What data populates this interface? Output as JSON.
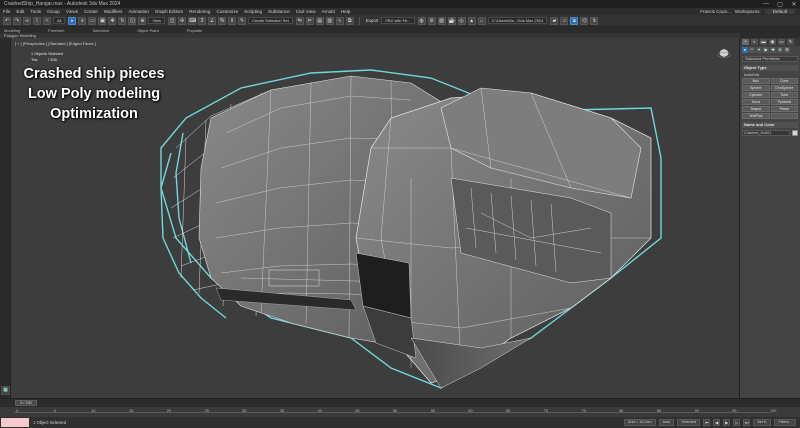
{
  "window": {
    "title": "CrashedShip_Hangar.max - Autodesk 3ds Max 2024",
    "min_label": "—",
    "max_label": "▢",
    "close_label": "✕"
  },
  "menu": {
    "items": [
      "File",
      "Edit",
      "Tools",
      "Group",
      "Views",
      "Create",
      "Modifiers",
      "Animation",
      "Graph Editors",
      "Rendering",
      "Customize",
      "Scripting",
      "Substance",
      "Civil View",
      "Arnold",
      "Help"
    ],
    "user": "Francis Coun...",
    "workspaces_label": "Workspaces:",
    "workspace_value": "Default"
  },
  "toolbar": {
    "undo_label": "↶",
    "redo_label": "↷",
    "filter_value": "All",
    "view_value": "View",
    "selection_set_value": "Create Selection Set",
    "export_label": "Export",
    "fbx_value": "FBX with Fb...",
    "project_value": "C:\\Users\\Ma...\\3ds Max 2024"
  },
  "ribbon": {
    "tabs": [
      "Modeling",
      "Freeform",
      "Selection",
      "Object Paint",
      "Populate"
    ],
    "sub_label": "Polygon Modeling"
  },
  "viewport": {
    "label": "[ + ] [Perspective ] [Standard ] [Edged Faces ]",
    "stats_selected": "1 Objects Selected",
    "stats_tris_label": "Tris:",
    "stats_tris_value": "7 836",
    "caption_line1": "Crashed ship pieces",
    "caption_line2": "Low Poly modeling",
    "caption_line3": "Optimization"
  },
  "command_panel": {
    "tabs": [
      "+",
      "◐",
      "▬",
      "◉",
      "▭",
      "✎"
    ],
    "dropdown_value": "Standard Primitives",
    "object_type_title": "Object Type",
    "autogrid_label": "AutoGrid",
    "buttons": [
      "Box",
      "Cone",
      "Sphere",
      "GeoSphere",
      "Cylinder",
      "Tube",
      "Torus",
      "Pyramid",
      "Teapot",
      "Plane",
      "TextPlus",
      ""
    ],
    "name_color_title": "Name and Color",
    "name_value": "Crashed_Hull01",
    "swatch_color": "#d8d8d8"
  },
  "timeline": {
    "slider_label": "0 / 100",
    "ticks": [
      "0",
      "5",
      "10",
      "15",
      "20",
      "25",
      "30",
      "35",
      "40",
      "45",
      "50",
      "55",
      "60",
      "65",
      "70",
      "75",
      "80",
      "85",
      "90",
      "95",
      "100"
    ]
  },
  "statusbar": {
    "status_text": "1 Object Selected",
    "grid_label": "Grid = 10,0cm",
    "auto_label": "Auto",
    "selected_value": "Selected",
    "setkey_label": "Set K.",
    "filters_label": "Filters..."
  },
  "colors": {
    "selection_highlight": "#6fd8d8",
    "viewport_bg": "#3d3d3d"
  }
}
